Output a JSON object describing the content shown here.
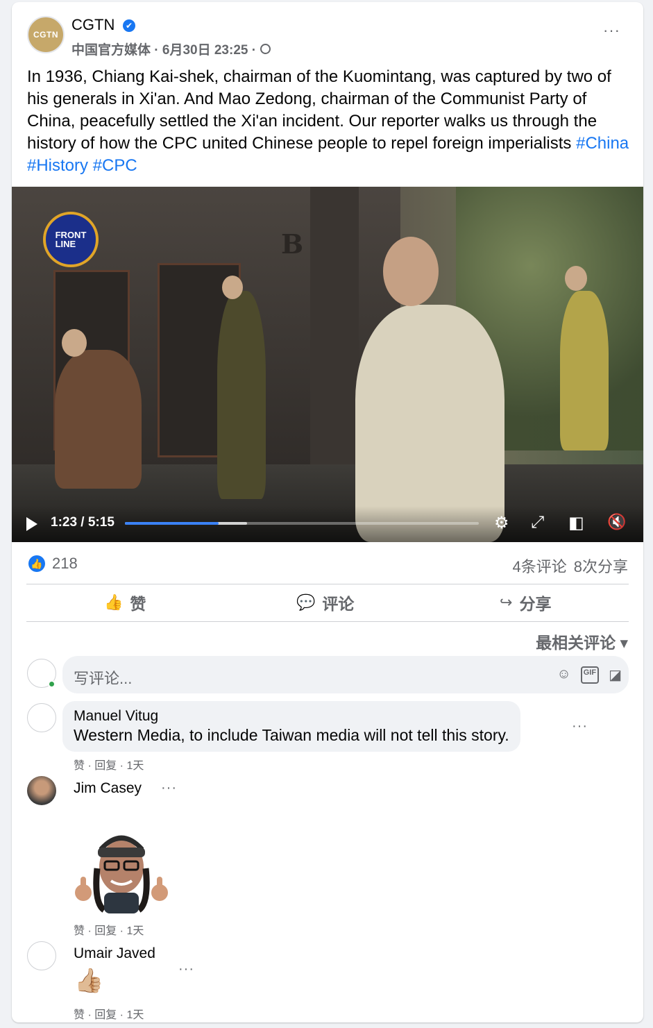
{
  "post": {
    "page_name": "CGTN",
    "page_logo_text": "CGTN",
    "verified_icon": "✔",
    "meta": "中国官方媒体 · 6月30日 23:25 ·",
    "more": "···",
    "text": "In 1936, Chiang Kai-shek, chairman of the Kuomintang, was captured by two of his generals in Xi'an. And Mao Zedong, chairman of the Communist Party of China, peacefully settled the Xi'an incident. Our reporter walks us through the history of how the CPC united Chinese people to repel foreign imperialists",
    "hashtags": "#China #History #CPC"
  },
  "video": {
    "badge_line1": "FRONT",
    "badge_line2": "LINE",
    "building_letter": "B",
    "time": "1:23 / 5:15",
    "progress": 0.264,
    "buffered": 0.345,
    "icons": {
      "settings": "⚙",
      "fullscreen": "⤢",
      "pip": "◧",
      "mute": "🔇"
    }
  },
  "stats": {
    "like_icon": "👍",
    "likes": "218",
    "comments": "4条评论",
    "shares": "8次分享"
  },
  "actions": {
    "like": "赞",
    "comment": "评论",
    "share": "分享",
    "like_icon": "👍",
    "comment_icon": "💬",
    "share_icon": "↪"
  },
  "sort": "最相关评论 ▾",
  "comment_input": {
    "placeholder": "写评论...",
    "emoji_icon": "☺",
    "gif_icon": "GIF",
    "sticker_icon": "◪"
  },
  "comments": [
    {
      "name": "Manuel Vitug",
      "text": "Western Media, to include Taiwan media will not tell this story.",
      "actions": "赞 · 回复 · 1天"
    },
    {
      "name": "Jim Casey",
      "text": "",
      "actions": "赞 · 回复 · 1天"
    },
    {
      "name": "Umair Javed",
      "text": "👍🏼",
      "actions": "赞 · 回复 · 1天"
    }
  ],
  "colors": {
    "accent": "#1877f2",
    "secondary_text": "#65676b",
    "progress": "#3b82f6",
    "online": "#31a24c"
  }
}
